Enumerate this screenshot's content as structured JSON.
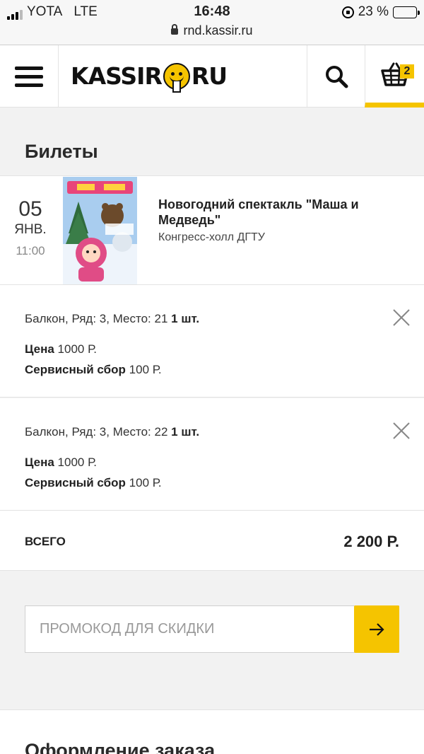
{
  "status_bar": {
    "carrier": "YOTA",
    "network": "LTE",
    "time": "16:48",
    "battery": "23 %",
    "battery_level": 0.23,
    "url": "rnd.kassir.ru"
  },
  "header": {
    "logo_left": "KASSIR",
    "logo_right": "RU",
    "cart_count": "2",
    "accent": "#f5c400"
  },
  "page": {
    "title": "Билеты"
  },
  "event": {
    "day": "05",
    "month": "ЯНВ.",
    "time": "11:00",
    "name": "Новогодний спектакль \"Маша и Медведь\"",
    "venue": "Конгресс-холл ДГТУ"
  },
  "tickets": [
    {
      "seat": "Балкон, Ряд: 3, Место: 21",
      "qty": "1 шт.",
      "price_label": "Цена",
      "price": "1000 Р.",
      "fee_label": "Сервисный сбор",
      "fee": "100 Р."
    },
    {
      "seat": "Балкон, Ряд: 3, Место: 22",
      "qty": "1 шт.",
      "price_label": "Цена",
      "price": "1000 Р.",
      "fee_label": "Сервисный сбор",
      "fee": "100 Р."
    }
  ],
  "total": {
    "label": "ВСЕГО",
    "value": "2 200 Р."
  },
  "promo": {
    "placeholder": "ПРОМОКОД ДЛЯ СКИДКИ"
  },
  "checkout": {
    "title": "Оформление заказа"
  }
}
